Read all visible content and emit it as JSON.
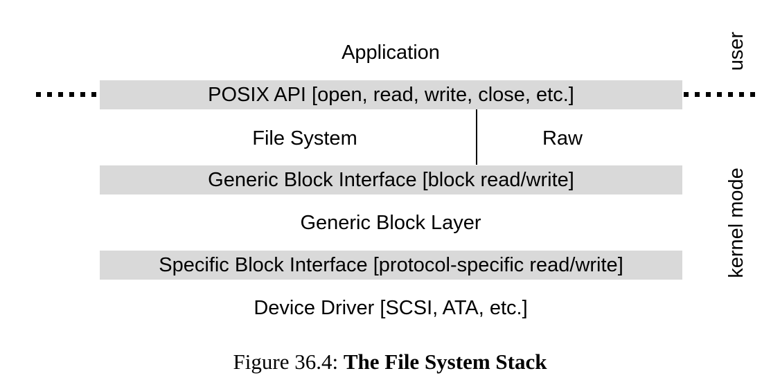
{
  "diagram": {
    "layers": {
      "application": "Application",
      "posix_api": "POSIX API [open, read, write, close, etc.]",
      "file_system": "File System",
      "raw": "Raw",
      "generic_block_interface": "Generic Block Interface [block read/write]",
      "generic_block_layer": "Generic Block Layer",
      "specific_block_interface": "Specific Block Interface [protocol-specific read/write]",
      "device_driver": "Device Driver [SCSI, ATA, etc.]"
    },
    "side_labels": {
      "user": "user",
      "kernel_mode": "kernel mode"
    }
  },
  "caption": {
    "prefix": "Figure 36.4:",
    "title": "The File System Stack"
  },
  "colors": {
    "band_fill": "#d9d9d9",
    "text": "#000000"
  }
}
